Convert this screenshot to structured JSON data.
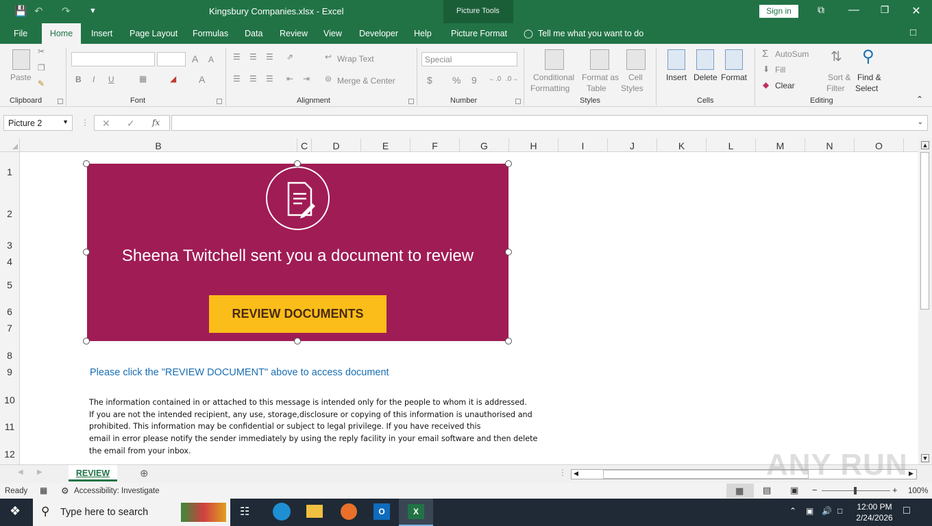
{
  "title_bar": {
    "title": "Kingsbury Companies.xlsx  -  Excel",
    "picture_tools": "Picture Tools",
    "sign_in": "Sign in"
  },
  "tabs": [
    "File",
    "Home",
    "Insert",
    "Page Layout",
    "Formulas",
    "Data",
    "Review",
    "View",
    "Developer",
    "Help",
    "Picture Format"
  ],
  "active_tab": "Home",
  "tell_me": "Tell me what you want to do",
  "ribbon": {
    "clipboard": {
      "paste": "Paste",
      "label": "Clipboard"
    },
    "font": {
      "label": "Font",
      "bold": "B",
      "italic": "I",
      "underline": "U",
      "grow": "A",
      "shrink": "A",
      "color": "A"
    },
    "alignment": {
      "wrap_text": "Wrap Text",
      "merge_center": "Merge & Center",
      "label": "Alignment"
    },
    "number": {
      "format": "Special",
      "currency": "$",
      "percent": "%",
      "comma": "9",
      "label": "Number"
    },
    "styles": {
      "conditional": "Conditional",
      "formatting": "Formatting",
      "format_as": "Format as",
      "table": "Table",
      "cell": "Cell",
      "styles_btn": "Styles",
      "label": "Styles"
    },
    "cells": {
      "insert": "Insert",
      "delete": "Delete",
      "format": "Format",
      "label": "Cells"
    },
    "editing": {
      "autosum": "AutoSum",
      "fill": "Fill",
      "clear": "Clear",
      "sort": "Sort &",
      "filter": "Filter",
      "find": "Find &",
      "select": "Select",
      "label": "Editing"
    }
  },
  "name_box": "Picture 2",
  "fx_label": "fx",
  "columns": [
    "B",
    "C",
    "D",
    "E",
    "F",
    "G",
    "H",
    "I",
    "J",
    "K",
    "L",
    "M",
    "N",
    "O"
  ],
  "rows": [
    "1",
    "2",
    "3",
    "4",
    "5",
    "6",
    "7",
    "8",
    "9",
    "10",
    "11",
    "12"
  ],
  "banner": {
    "message": "Sheena Twitchell sent you a document to review",
    "button": "REVIEW DOCUMENTS"
  },
  "instruction": "Please click the \"REVIEW DOCUMENT\" above to access document",
  "disclaimer": [
    "The information contained in or attached to this message is intended only for the people to whom it is addressed.",
    "If you are not the intended recipient, any use, storage,disclosure or copying of this information is unauthorised and",
    "prohibited. This information may be confidential or subject to legal privilege. If you have received this",
    "email in error please notify the sender immediately by using the reply facility in your email software and then delete",
    "the email from your inbox."
  ],
  "sheet_tab": "REVIEW",
  "status": {
    "ready": "Ready",
    "accessibility": "Accessibility: Investigate",
    "zoom": "100%"
  },
  "taskbar": {
    "search_placeholder": "Type here to search",
    "time": "12:00 PM",
    "date": "2/24/2026"
  },
  "watermark": "ANY RUN",
  "colors": {
    "excel_green": "#217346",
    "banner": "#a01c55",
    "button": "#fbbd19",
    "link": "#1a6fb3"
  }
}
